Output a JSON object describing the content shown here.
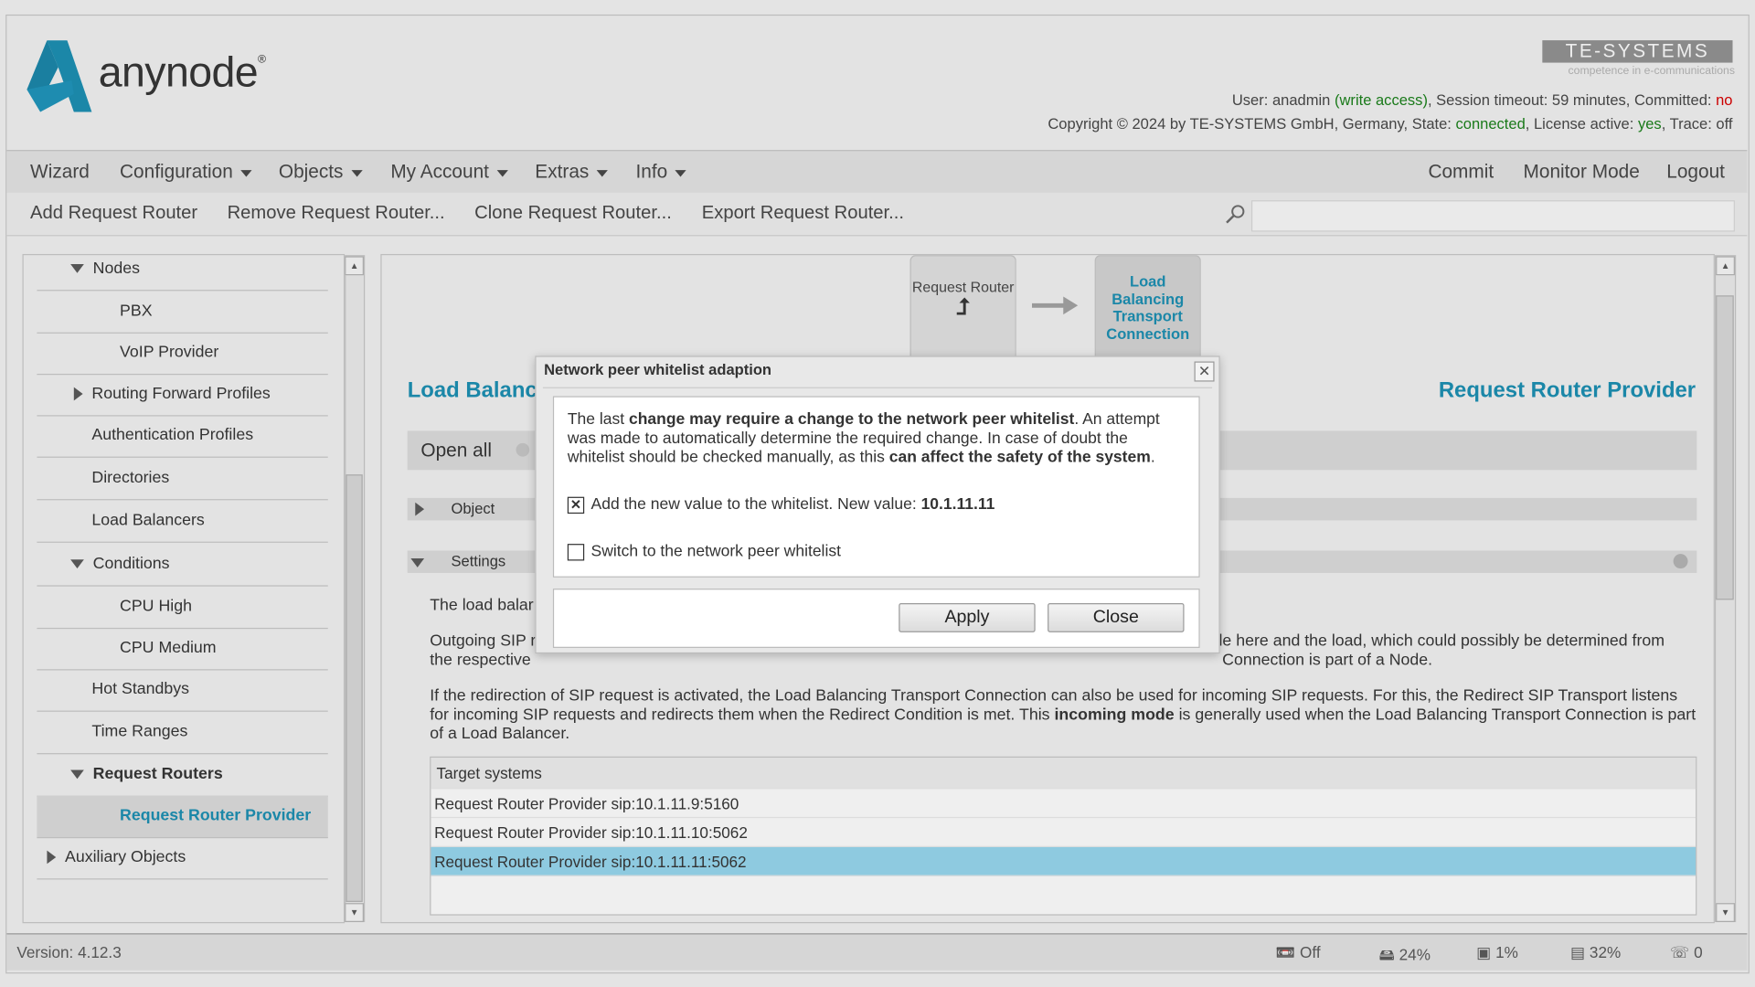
{
  "header": {
    "logo_text": "anynode",
    "brand": "TE-SYSTEMS",
    "brand_tagline": "competence in e-communications",
    "user_label": "User:",
    "user": "anadmin",
    "access": "(write access)",
    "session": ", Session timeout: 59 minutes, Committed:",
    "committed": "no",
    "copyright": "Copyright © 2024 by TE-SYSTEMS GmbH, Germany, State:",
    "state": "connected",
    "license_label": ", License active:",
    "license": "yes",
    "trace": ", Trace: off"
  },
  "menu": {
    "left": [
      "Wizard",
      "Configuration",
      "Objects",
      "My Account",
      "Extras",
      "Info"
    ],
    "right": [
      "Commit",
      "Monitor Mode",
      "Logout"
    ]
  },
  "toolbar": {
    "items": [
      "Add Request Router",
      "Remove Request Router...",
      "Clone Request Router...",
      "Export Request Router..."
    ],
    "search_value": ""
  },
  "sidebar": {
    "items": [
      {
        "label": "Nodes"
      },
      {
        "label": "PBX"
      },
      {
        "label": "VoIP Provider"
      },
      {
        "label": "Routing Forward Profiles"
      },
      {
        "label": "Authentication Profiles"
      },
      {
        "label": "Directories"
      },
      {
        "label": "Load Balancers"
      },
      {
        "label": "Conditions"
      },
      {
        "label": "CPU High"
      },
      {
        "label": "CPU Medium"
      },
      {
        "label": "Hot Standbys"
      },
      {
        "label": "Time Ranges"
      },
      {
        "label": "Request Routers"
      },
      {
        "label": "Request Router Provider"
      },
      {
        "label": "Auxiliary Objects"
      }
    ]
  },
  "main": {
    "flow_left": "Request Router",
    "flow_right": "Load Balancing Transport Connection",
    "title_left": "Load Balanc",
    "title_right": "Request Router Provider",
    "open_all": "Open all",
    "section_object": "Object",
    "section_settings": "Settings",
    "p1": "The load balar",
    "p2a": "Outgoing SIP r",
    "p2b": "le here and the load, which could possibly be determined from",
    "p2c": "the respective",
    "p2d": "Connection is part of a Node.",
    "p3a": "If the redirection of SIP request is activated, the Load Balancing Transport Connection can also be used for incoming SIP requests. For this, the Redirect SIP Transport listens for incoming SIP requests and redirects them when the Redirect Condition is met. This ",
    "p3b": "incoming mode",
    "p3c": " is generally used when the Load Balancing Transport Connection is part of a Load Balancer.",
    "table_header": "Target systems",
    "rows": [
      "Request Router Provider sip:10.1.11.9:5160",
      "Request Router Provider sip:10.1.11.10:5062",
      "Request Router Provider sip:10.1.11.11:5062"
    ]
  },
  "dialog": {
    "title": "Network peer whitelist adaption",
    "t1": "The last ",
    "t2": "change may require a change to the network peer whitelist",
    "t3": ". An attempt was made to automatically determine the required change. In case of doubt the whitelist should be checked manually, as this ",
    "t4": "can affect the safety of the system",
    "t5": ".",
    "opt1": "Add the new value to the whitelist. New value: ",
    "opt1_value": "10.1.11.11",
    "opt1_checked": true,
    "opt2": "Switch to the network peer whitelist",
    "opt2_checked": false,
    "apply": "Apply",
    "close": "Close"
  },
  "status": {
    "version": "Version: 4.12.3",
    "record": "Off",
    "disk": "24%",
    "cpu": "1%",
    "memory": "32%",
    "calls": "0"
  },
  "colors": {
    "accent": "#1b87a8",
    "selected_row": "#8ecae0",
    "green": "#1a7a1a",
    "red": "#cc0000"
  }
}
